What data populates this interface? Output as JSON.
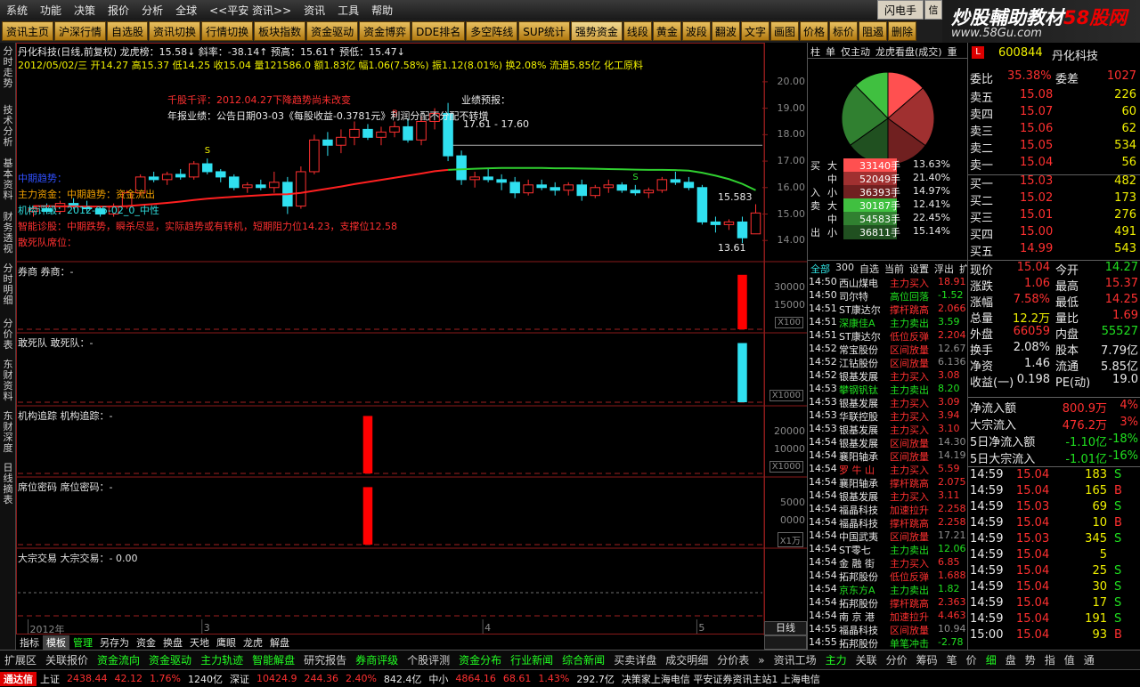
{
  "menu": {
    "items": [
      "系统",
      "功能",
      "决策",
      "报价",
      "分析",
      "全球",
      "<<平安 资讯>>",
      "资讯",
      "工具",
      "帮助"
    ],
    "ticker": "",
    "ad": "",
    "flash": "闪电手",
    "flash2": "信"
  },
  "brand": {
    "title_a": "炒股輔助教材",
    "title_b": "58股网",
    "url": "www.58Gu.com"
  },
  "toolbar": {
    "items": [
      "资讯主页",
      "沪深行情",
      "自选股",
      "资讯切换",
      "行情切换",
      "板块指数",
      "资金驱动",
      "资金博弈",
      "DDE排名",
      "多空阵线",
      "SUP统计",
      "强势资金",
      "线段",
      "黄金",
      "波段",
      "翻波",
      "文字",
      "画图",
      "价格",
      "标价",
      "阻遏",
      "删除"
    ],
    "active_index": 11
  },
  "lefttabs": [
    "分时走势",
    "技术分析",
    "基本资料",
    "财务透视",
    "分时明细",
    "分价表",
    "东财资料",
    "东财深度",
    "日线摘表"
  ],
  "chart": {
    "title": "丹化科技(日线,前复权) 龙虎榜：15.58↓ 斜率：-38.14↑ 预高：15.61↑ 预低：15.47↓",
    "line2": "2012/05/02/三 开14.27 高15.37 低14.25 收15.04 量121586.0 额1.83亿 幅1.06(7.58%) 振1.12(8.01%) 换2.08% 流通5.85亿 化工原料",
    "ann1": "千股千评：2012.04.27下降趋势尚未改变",
    "ann2": "年报业绩：公告日期03-03《每股收益-0.3781元》利润分配不分配不转增",
    "ann3": "业绩预报：",
    "ann4": "17.61 - 17.60",
    "ann5": "中期趋势：",
    "ann6": "主力资金：中期趋势：资金流出",
    "ann7": "机构评级：2012-05-02_0_中性",
    "ann8": "智能诊股：中期跌势，瞬杀尽显，实际趋势或有转机，短期阻力位14.23，支撑位12.58",
    "ann9": "散死队席位：",
    "last_marker": "15.583",
    "low_marker": "13.61",
    "yticks": [
      "20.00",
      "19.00",
      "18.00",
      "17.00",
      "16.00",
      "15.00",
      "14.00"
    ],
    "date_labels": [
      "2012年",
      "3",
      "4",
      "5"
    ],
    "panels": [
      {
        "label": "券商 券商：-",
        "yticks": [
          "30000",
          "15000"
        ],
        "unit": "X100"
      },
      {
        "label": "敢死队 敢死队：-",
        "yticks": [],
        "unit": "X1000"
      },
      {
        "label": "机构追踪 机构追踪：-",
        "yticks": [
          "20000",
          "10000"
        ],
        "unit": "X1000"
      },
      {
        "label": "席位密码 席位密码：-",
        "yticks": [
          "5000",
          "0000"
        ],
        "unit": "X1万"
      },
      {
        "label": "大宗交易 大宗交易：- 0.00",
        "yticks": [],
        "unit": ""
      }
    ]
  },
  "chart_data": {
    "type": "candlestick",
    "ylim": [
      13.2,
      20.4
    ],
    "candles": [
      [
        15.1,
        15.3,
        14.9,
        15.2
      ],
      [
        15.2,
        15.4,
        15.0,
        15.1
      ],
      [
        15.1,
        15.5,
        15.0,
        15.4
      ],
      [
        15.4,
        15.6,
        15.2,
        15.3
      ],
      [
        15.3,
        15.5,
        15.1,
        15.2
      ],
      [
        15.2,
        15.3,
        14.9,
        15.0
      ],
      [
        15.0,
        15.4,
        14.9,
        15.3
      ],
      [
        15.3,
        15.9,
        15.2,
        15.8
      ],
      [
        15.8,
        16.5,
        15.7,
        16.4
      ],
      [
        16.4,
        16.6,
        16.2,
        16.3
      ],
      [
        16.3,
        16.6,
        16.1,
        16.5
      ],
      [
        16.5,
        16.7,
        16.3,
        16.4
      ],
      [
        16.4,
        17.0,
        16.3,
        16.9
      ],
      [
        16.9,
        17.1,
        16.5,
        16.6
      ],
      [
        16.6,
        16.7,
        16.2,
        16.4
      ],
      [
        16.4,
        16.5,
        15.9,
        16.0
      ],
      [
        16.0,
        16.2,
        15.8,
        16.1
      ],
      [
        16.1,
        16.3,
        15.9,
        16.0
      ],
      [
        16.0,
        16.6,
        15.8,
        16.2
      ],
      [
        16.2,
        16.4,
        15.0,
        15.3
      ],
      [
        15.3,
        16.8,
        15.2,
        16.6
      ],
      [
        16.6,
        18.0,
        16.5,
        17.8
      ],
      [
        17.8,
        18.1,
        17.2,
        17.6
      ],
      [
        17.6,
        18.2,
        17.3,
        17.9
      ],
      [
        17.9,
        18.5,
        17.6,
        18.2
      ],
      [
        18.2,
        18.4,
        17.8,
        17.9
      ],
      [
        17.9,
        18.3,
        17.6,
        18.1
      ],
      [
        18.1,
        18.5,
        17.9,
        18.3
      ],
      [
        18.3,
        18.6,
        17.7,
        17.8
      ],
      [
        17.8,
        18.7,
        17.6,
        18.5
      ],
      [
        18.5,
        19.0,
        18.2,
        18.8
      ],
      [
        18.8,
        19.2,
        17.0,
        17.2
      ],
      [
        17.2,
        17.4,
        16.1,
        16.3
      ],
      [
        16.3,
        16.6,
        16.0,
        16.4
      ],
      [
        16.4,
        16.7,
        16.2,
        16.3
      ],
      [
        16.3,
        16.5,
        15.9,
        16.2
      ],
      [
        16.2,
        16.4,
        15.6,
        15.8
      ],
      [
        15.8,
        16.3,
        15.7,
        16.1
      ],
      [
        16.1,
        16.3,
        15.9,
        16.0
      ],
      [
        16.0,
        16.2,
        15.7,
        15.9
      ],
      [
        15.9,
        16.2,
        15.7,
        16.1
      ],
      [
        16.1,
        16.3,
        15.5,
        15.7
      ],
      [
        15.7,
        16.1,
        15.6,
        16.0
      ],
      [
        16.0,
        16.3,
        15.8,
        16.1
      ],
      [
        16.1,
        16.2,
        15.8,
        15.9
      ],
      [
        15.9,
        16.1,
        15.7,
        15.8
      ],
      [
        15.8,
        16.0,
        15.6,
        15.9
      ],
      [
        15.9,
        16.4,
        15.8,
        16.3
      ],
      [
        16.3,
        16.6,
        16.1,
        16.2
      ],
      [
        16.2,
        16.4,
        15.9,
        16.0
      ],
      [
        16.0,
        16.1,
        14.6,
        14.7
      ],
      [
        14.7,
        14.9,
        14.3,
        14.6
      ],
      [
        14.6,
        14.8,
        14.4,
        14.7
      ],
      [
        14.7,
        14.9,
        13.9,
        14.1
      ],
      [
        14.25,
        15.37,
        14.25,
        15.04
      ]
    ],
    "ma": [
      15.3,
      15.3,
      15.29,
      15.29,
      15.28,
      15.28,
      15.28,
      15.3,
      15.34,
      15.38,
      15.42,
      15.47,
      15.53,
      15.58,
      15.62,
      15.65,
      15.68,
      15.71,
      15.74,
      15.75,
      15.8,
      15.88,
      15.96,
      16.04,
      16.13,
      16.21,
      16.29,
      16.37,
      16.45,
      16.53,
      16.62,
      16.67,
      16.69,
      16.71,
      16.73,
      16.74,
      16.74,
      16.74,
      16.74,
      16.73,
      16.73,
      16.72,
      16.71,
      16.7,
      16.69,
      16.68,
      16.67,
      16.67,
      16.66,
      16.64,
      16.56,
      16.45,
      16.32,
      16.14,
      15.9
    ],
    "ma_change_index": 31,
    "panel_bars": [
      {
        "index": 53,
        "value": 0.9,
        "color": "#ff0000"
      },
      {
        "index": 53,
        "value": 0.95,
        "color": "#30e0f0"
      },
      {
        "index": 25,
        "value": 0.95,
        "color": "#ff0000"
      },
      {
        "index": 25,
        "value": 0.95,
        "color": "#ff0000"
      }
    ],
    "signals": [
      {
        "index": 13,
        "label": "S",
        "color": "#f0f000"
      },
      {
        "index": 27,
        "label": "B",
        "color": "#ff3030"
      },
      {
        "index": 45,
        "label": "S",
        "color": "#30e030"
      }
    ]
  },
  "mid": {
    "tabs": [
      "柱",
      "单",
      "仅主动",
      "龙虎看盘(成交)",
      "重"
    ],
    "pie": [
      {
        "label": "大",
        "pct": 13.63,
        "color": "#ff5050"
      },
      {
        "label": "中",
        "pct": 21.4,
        "color": "#a03030"
      },
      {
        "label": "小",
        "pct": 14.97,
        "color": "#702020"
      },
      {
        "label": "大",
        "pct": 12.41,
        "color": "#40c040"
      },
      {
        "label": "中",
        "pct": 22.45,
        "color": "#308030"
      },
      {
        "label": "小",
        "pct": 15.14,
        "color": "#205020"
      }
    ],
    "flow": [
      {
        "side": "买",
        "size": "大",
        "vol": "33140手",
        "pct": "13.63%",
        "color": "#ff5050"
      },
      {
        "side": "",
        "size": "中",
        "vol": "52049手",
        "pct": "21.40%",
        "color": "#a03030"
      },
      {
        "side": "入",
        "size": "小",
        "vol": "36393手",
        "pct": "14.97%",
        "color": "#702020"
      },
      {
        "side": "卖",
        "size": "大",
        "vol": "30187手",
        "pct": "12.41%",
        "color": "#40c040"
      },
      {
        "side": "",
        "size": "中",
        "vol": "54583手",
        "pct": "22.45%",
        "color": "#308030"
      },
      {
        "side": "出",
        "size": "小",
        "vol": "36811手",
        "pct": "15.14%",
        "color": "#205020"
      }
    ],
    "deal_tabs": [
      "全部",
      "300",
      "自选",
      "当前",
      "设置",
      "浮出",
      "扩"
    ],
    "deals": [
      {
        "t": "14:50",
        "n": "西山煤电",
        "a": "主力买入",
        "v": "18.91",
        "nc": "white",
        "ac": "red",
        "vc": "red"
      },
      {
        "t": "14:50",
        "n": "司尔特",
        "a": "高位回落",
        "v": "-1.52",
        "nc": "white",
        "ac": "green",
        "vc": "green"
      },
      {
        "t": "14:51",
        "n": "ST康达尔",
        "a": "撑杆跳高",
        "v": "2.066",
        "nc": "white",
        "ac": "red",
        "vc": "red"
      },
      {
        "t": "14:51",
        "n": "深康佳A",
        "a": "主力卖出",
        "v": "3.59",
        "nc": "green",
        "ac": "green",
        "vc": "green"
      },
      {
        "t": "14:51",
        "n": "ST康达尔",
        "a": "低位反弹",
        "v": "2.204",
        "nc": "white",
        "ac": "red",
        "vc": "red"
      },
      {
        "t": "14:52",
        "n": "常宝股份",
        "a": "区间放量",
        "v": "12.67",
        "nc": "white",
        "ac": "red",
        "vc": "gray"
      },
      {
        "t": "14:52",
        "n": "江钻股份",
        "a": "区间放量",
        "v": "6.136",
        "nc": "white",
        "ac": "red",
        "vc": "gray"
      },
      {
        "t": "14:52",
        "n": "银基发展",
        "a": "主力买入",
        "v": "3.08",
        "nc": "white",
        "ac": "red",
        "vc": "red"
      },
      {
        "t": "14:53",
        "n": "攀钢钒钛",
        "a": "主力卖出",
        "v": "8.20",
        "nc": "green",
        "ac": "green",
        "vc": "green"
      },
      {
        "t": "14:53",
        "n": "银基发展",
        "a": "主力买入",
        "v": "3.09",
        "nc": "white",
        "ac": "red",
        "vc": "red"
      },
      {
        "t": "14:53",
        "n": "华联控股",
        "a": "主力买入",
        "v": "3.94",
        "nc": "white",
        "ac": "red",
        "vc": "red"
      },
      {
        "t": "14:53",
        "n": "银基发展",
        "a": "主力买入",
        "v": "3.10",
        "nc": "white",
        "ac": "red",
        "vc": "red"
      },
      {
        "t": "14:54",
        "n": "银基发展",
        "a": "区间放量",
        "v": "14.30",
        "nc": "white",
        "ac": "red",
        "vc": "gray"
      },
      {
        "t": "14:54",
        "n": "襄阳轴承",
        "a": "区间放量",
        "v": "14.19",
        "nc": "white",
        "ac": "red",
        "vc": "gray"
      },
      {
        "t": "14:54",
        "n": "罗 牛 山",
        "a": "主力买入",
        "v": "5.59",
        "nc": "red",
        "ac": "red",
        "vc": "red"
      },
      {
        "t": "14:54",
        "n": "襄阳轴承",
        "a": "撑杆跳高",
        "v": "2.075",
        "nc": "white",
        "ac": "red",
        "vc": "red"
      },
      {
        "t": "14:54",
        "n": "银基发展",
        "a": "主力买入",
        "v": "3.11",
        "nc": "white",
        "ac": "red",
        "vc": "red"
      },
      {
        "t": "14:54",
        "n": "福晶科技",
        "a": "加速拉升",
        "v": "2.258",
        "nc": "white",
        "ac": "red",
        "vc": "red"
      },
      {
        "t": "14:54",
        "n": "福晶科技",
        "a": "撑杆跳高",
        "v": "2.258",
        "nc": "white",
        "ac": "red",
        "vc": "red"
      },
      {
        "t": "14:54",
        "n": "中国武夷",
        "a": "区间放量",
        "v": "17.21",
        "nc": "white",
        "ac": "red",
        "vc": "gray"
      },
      {
        "t": "14:54",
        "n": "ST零七",
        "a": "主力卖出",
        "v": "12.06",
        "nc": "white",
        "ac": "green",
        "vc": "green"
      },
      {
        "t": "14:54",
        "n": "金 融 街",
        "a": "主力买入",
        "v": "6.85",
        "nc": "white",
        "ac": "red",
        "vc": "red"
      },
      {
        "t": "14:54",
        "n": "拓邦股份",
        "a": "低位反弹",
        "v": "1.688",
        "nc": "white",
        "ac": "red",
        "vc": "red"
      },
      {
        "t": "14:54",
        "n": "京东方A",
        "a": "主力卖出",
        "v": "1.82",
        "nc": "green",
        "ac": "green",
        "vc": "green"
      },
      {
        "t": "14:54",
        "n": "拓邦股份",
        "a": "撑杆跳高",
        "v": "2.363",
        "nc": "white",
        "ac": "red",
        "vc": "red"
      },
      {
        "t": "14:54",
        "n": "南 京 港",
        "a": "加速拉升",
        "v": "4.463",
        "nc": "white",
        "ac": "red",
        "vc": "red"
      },
      {
        "t": "14:55",
        "n": "福晶科技",
        "a": "区间放量",
        "v": "10.94",
        "nc": "white",
        "ac": "red",
        "vc": "gray"
      },
      {
        "t": "14:55",
        "n": "拓邦股份",
        "a": "单笔冲击",
        "v": "-2.78",
        "nc": "white",
        "ac": "green",
        "vc": "green"
      }
    ]
  },
  "quote": {
    "code": "600844",
    "name": "丹化科技",
    "weibi_label": "委比",
    "weibi": "35.38%",
    "weicha_label": "委差",
    "weicha": "1027",
    "asks": [
      {
        "l": "卖五",
        "p": "15.08",
        "v": "226",
        "pc": "red"
      },
      {
        "l": "卖四",
        "p": "15.07",
        "v": "60",
        "pc": "red"
      },
      {
        "l": "卖三",
        "p": "15.06",
        "v": "62",
        "pc": "red"
      },
      {
        "l": "卖二",
        "p": "15.05",
        "v": "534",
        "pc": "red"
      },
      {
        "l": "卖一",
        "p": "15.04",
        "v": "56",
        "pc": "red"
      }
    ],
    "bids": [
      {
        "l": "买一",
        "p": "15.03",
        "v": "482",
        "pc": "red"
      },
      {
        "l": "买二",
        "p": "15.02",
        "v": "173",
        "pc": "red"
      },
      {
        "l": "买三",
        "p": "15.01",
        "v": "276",
        "pc": "red"
      },
      {
        "l": "买四",
        "p": "15.00",
        "v": "491",
        "pc": "red"
      },
      {
        "l": "买五",
        "p": "14.99",
        "v": "543",
        "pc": "red"
      }
    ],
    "stats": [
      {
        "a": "现价",
        "av": "15.04",
        "ac": "red",
        "b": "今开",
        "bv": "14.27",
        "bc": "green"
      },
      {
        "a": "涨跌",
        "av": "1.06",
        "ac": "red",
        "b": "最高",
        "bv": "15.37",
        "bc": "red"
      },
      {
        "a": "涨幅",
        "av": "7.58%",
        "ac": "red",
        "b": "最低",
        "bv": "14.25",
        "bc": "red"
      },
      {
        "a": "总量",
        "av": "12.2万",
        "ac": "yellow",
        "b": "量比",
        "bv": "1.69",
        "bc": "red"
      },
      {
        "a": "外盘",
        "av": "66059",
        "ac": "red",
        "b": "内盘",
        "bv": "55527",
        "bc": "green"
      },
      {
        "a": "换手",
        "av": "2.08%",
        "ac": "white",
        "b": "股本",
        "bv": "7.79亿",
        "bc": "white"
      },
      {
        "a": "净资",
        "av": "1.46",
        "ac": "white",
        "b": "流通",
        "bv": "5.85亿",
        "bc": "white"
      },
      {
        "a": "收益(一)",
        "av": "0.198",
        "ac": "white",
        "b": "PE(动)",
        "bv": "19.0",
        "bc": "white"
      }
    ],
    "net": [
      {
        "l": "净流入额",
        "v": "800.9万",
        "p": "4%",
        "c": "red"
      },
      {
        "l": "大宗流入",
        "v": "476.2万",
        "p": "3%",
        "c": "red"
      },
      {
        "l": "5日净流入额",
        "v": "-1.10亿",
        "p": "-18%",
        "c": "green"
      },
      {
        "l": "5日大宗流入",
        "v": "-1.01亿",
        "p": "-16%",
        "c": "green"
      }
    ],
    "ticks": [
      {
        "t": "14:59",
        "p": "15.04",
        "v": "183",
        "d": "S",
        "dc": "green"
      },
      {
        "t": "14:59",
        "p": "15.04",
        "v": "165",
        "d": "B",
        "dc": "red"
      },
      {
        "t": "14:59",
        "p": "15.03",
        "v": "69",
        "d": "S",
        "dc": "green"
      },
      {
        "t": "14:59",
        "p": "15.04",
        "v": "10",
        "d": "B",
        "dc": "red"
      },
      {
        "t": "14:59",
        "p": "15.03",
        "v": "345",
        "d": "S",
        "dc": "green"
      },
      {
        "t": "14:59",
        "p": "15.04",
        "v": "5",
        "d": "",
        "dc": "white"
      },
      {
        "t": "14:59",
        "p": "15.04",
        "v": "25",
        "d": "S",
        "dc": "green"
      },
      {
        "t": "14:59",
        "p": "15.04",
        "v": "30",
        "d": "S",
        "dc": "green"
      },
      {
        "t": "14:59",
        "p": "15.04",
        "v": "17",
        "d": "S",
        "dc": "green"
      },
      {
        "t": "14:59",
        "p": "15.04",
        "v": "191",
        "d": "S",
        "dc": "green"
      },
      {
        "t": "15:00",
        "p": "15.04",
        "v": "93",
        "d": "B",
        "dc": "red"
      }
    ]
  },
  "bottomtabs": [
    "指标",
    "模板",
    "管理",
    "另存为",
    "资金",
    "换盘",
    "天地",
    "鹰眼",
    "龙虎",
    "解盘"
  ],
  "period": "日线",
  "navbar": [
    "扩展区",
    "关联报价",
    "资金流向",
    "资金驱动",
    "主力轨迹",
    "智能解盘",
    "研究报告",
    "券商评级",
    "个股评测",
    "资金分布",
    "行业新闻",
    "综合新闻",
    "买卖详盘",
    "成交明细",
    "分价表",
    "»",
    "资讯工场",
    "主力",
    "关联",
    "分价",
    "筹码",
    "笔",
    "价",
    "细",
    "盘",
    "势",
    "指",
    "值",
    "通"
  ],
  "status": {
    "sh_label": "上证",
    "sh_idx": "2438.44",
    "sh_chg": "42.12",
    "sh_pct": "1.76%",
    "sh_amt": "1240亿",
    "sz_label": "深证",
    "sz_idx": "10424.9",
    "sz_chg": "244.36",
    "sz_pct": "2.40%",
    "sz_amt": "842.4亿",
    "zx_label": "中小",
    "zx_idx": "4864.16",
    "zx_chg": "68.61",
    "zx_pct": "1.43%",
    "zx_amt": "292.7亿",
    "msg": "决策家上海电信 平安证券资讯主站1 上海电信"
  }
}
